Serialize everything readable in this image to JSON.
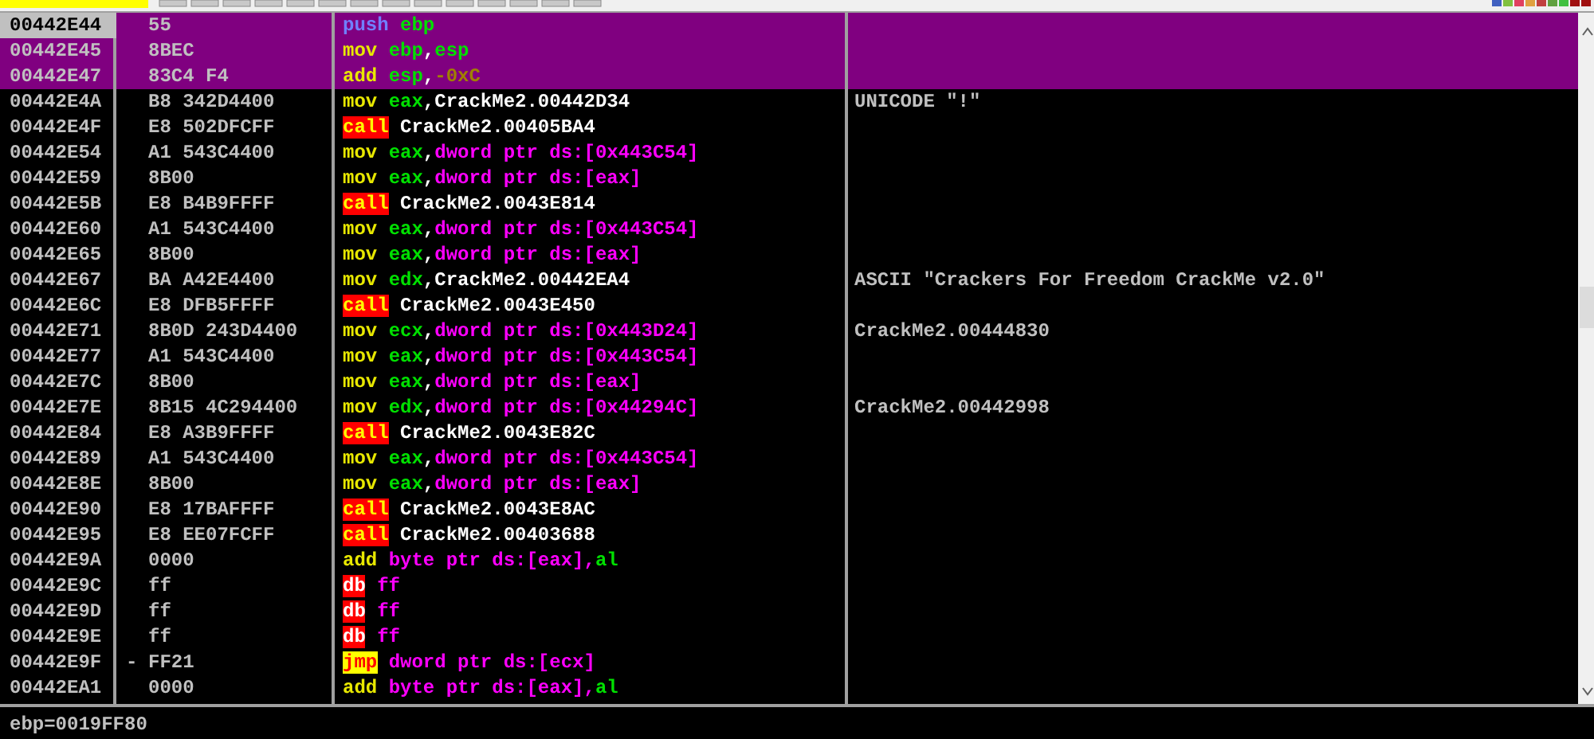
{
  "rows": [
    {
      "address": "00442E44",
      "hex": "55",
      "selected": true,
      "cursor": true,
      "mnemonic": {
        "text": "push",
        "kind": "push"
      },
      "operands": [
        {
          "text": "ebp",
          "kind": "reg"
        }
      ]
    },
    {
      "address": "00442E45",
      "hex": "8BEC",
      "selected": true,
      "cursor": false,
      "mnemonic": {
        "text": "mov",
        "kind": "op"
      },
      "operands": [
        {
          "text": "ebp",
          "kind": "reg"
        },
        {
          "text": ",",
          "kind": "plain"
        },
        {
          "text": "esp",
          "kind": "reg"
        }
      ]
    },
    {
      "address": "00442E47",
      "hex": "83C4 F4",
      "selected": true,
      "cursor": false,
      "mnemonic": {
        "text": "add",
        "kind": "op"
      },
      "operands": [
        {
          "text": "esp",
          "kind": "reg"
        },
        {
          "text": ",",
          "kind": "plain"
        },
        {
          "text": "-0xC",
          "kind": "const"
        }
      ]
    },
    {
      "address": "00442E4A",
      "hex": "B8 342D4400",
      "selected": false,
      "cursor": false,
      "mnemonic": {
        "text": "mov",
        "kind": "op"
      },
      "operands": [
        {
          "text": "eax",
          "kind": "reg"
        },
        {
          "text": ",CrackMe2.00442D34",
          "kind": "plain"
        }
      ],
      "comment": "UNICODE \"!\""
    },
    {
      "address": "00442E4F",
      "hex": "E8 502DFCFF",
      "selected": false,
      "cursor": false,
      "mnemonic": {
        "text": "call",
        "kind": "call"
      },
      "operands": [
        {
          "text": "CrackMe2.00405BA4",
          "kind": "plain"
        }
      ]
    },
    {
      "address": "00442E54",
      "hex": "A1 543C4400",
      "selected": false,
      "cursor": false,
      "mnemonic": {
        "text": "mov",
        "kind": "op"
      },
      "operands": [
        {
          "text": "eax",
          "kind": "reg"
        },
        {
          "text": ",",
          "kind": "plain"
        },
        {
          "text": "dword ptr ds:[0x443C54]",
          "kind": "mem"
        }
      ]
    },
    {
      "address": "00442E59",
      "hex": "8B00",
      "selected": false,
      "cursor": false,
      "mnemonic": {
        "text": "mov",
        "kind": "op"
      },
      "operands": [
        {
          "text": "eax",
          "kind": "reg"
        },
        {
          "text": ",",
          "kind": "plain"
        },
        {
          "text": "dword ptr ds:[eax]",
          "kind": "mem"
        }
      ]
    },
    {
      "address": "00442E5B",
      "hex": "E8 B4B9FFFF",
      "selected": false,
      "cursor": false,
      "mnemonic": {
        "text": "call",
        "kind": "call"
      },
      "operands": [
        {
          "text": "CrackMe2.0043E814",
          "kind": "plain"
        }
      ]
    },
    {
      "address": "00442E60",
      "hex": "A1 543C4400",
      "selected": false,
      "cursor": false,
      "mnemonic": {
        "text": "mov",
        "kind": "op"
      },
      "operands": [
        {
          "text": "eax",
          "kind": "reg"
        },
        {
          "text": ",",
          "kind": "plain"
        },
        {
          "text": "dword ptr ds:[0x443C54]",
          "kind": "mem"
        }
      ]
    },
    {
      "address": "00442E65",
      "hex": "8B00",
      "selected": false,
      "cursor": false,
      "mnemonic": {
        "text": "mov",
        "kind": "op"
      },
      "operands": [
        {
          "text": "eax",
          "kind": "reg"
        },
        {
          "text": ",",
          "kind": "plain"
        },
        {
          "text": "dword ptr ds:[eax]",
          "kind": "mem"
        }
      ]
    },
    {
      "address": "00442E67",
      "hex": "BA A42E4400",
      "selected": false,
      "cursor": false,
      "mnemonic": {
        "text": "mov",
        "kind": "op"
      },
      "operands": [
        {
          "text": "edx",
          "kind": "reg"
        },
        {
          "text": ",CrackMe2.00442EA4",
          "kind": "plain"
        }
      ],
      "comment": "ASCII \"Crackers For Freedom CrackMe v2.0\""
    },
    {
      "address": "00442E6C",
      "hex": "E8 DFB5FFFF",
      "selected": false,
      "cursor": false,
      "mnemonic": {
        "text": "call",
        "kind": "call"
      },
      "operands": [
        {
          "text": "CrackMe2.0043E450",
          "kind": "plain"
        }
      ]
    },
    {
      "address": "00442E71",
      "hex": "8B0D 243D4400",
      "selected": false,
      "cursor": false,
      "mnemonic": {
        "text": "mov",
        "kind": "op"
      },
      "operands": [
        {
          "text": "ecx",
          "kind": "reg"
        },
        {
          "text": ",",
          "kind": "plain"
        },
        {
          "text": "dword ptr ds:[0x443D24]",
          "kind": "mem"
        }
      ],
      "comment": "CrackMe2.00444830"
    },
    {
      "address": "00442E77",
      "hex": "A1 543C4400",
      "selected": false,
      "cursor": false,
      "mnemonic": {
        "text": "mov",
        "kind": "op"
      },
      "operands": [
        {
          "text": "eax",
          "kind": "reg"
        },
        {
          "text": ",",
          "kind": "plain"
        },
        {
          "text": "dword ptr ds:[0x443C54]",
          "kind": "mem"
        }
      ]
    },
    {
      "address": "00442E7C",
      "hex": "8B00",
      "selected": false,
      "cursor": false,
      "mnemonic": {
        "text": "mov",
        "kind": "op"
      },
      "operands": [
        {
          "text": "eax",
          "kind": "reg"
        },
        {
          "text": ",",
          "kind": "plain"
        },
        {
          "text": "dword ptr ds:[eax]",
          "kind": "mem"
        }
      ]
    },
    {
      "address": "00442E7E",
      "hex": "8B15 4C294400",
      "selected": false,
      "cursor": false,
      "mnemonic": {
        "text": "mov",
        "kind": "op"
      },
      "operands": [
        {
          "text": "edx",
          "kind": "reg"
        },
        {
          "text": ",",
          "kind": "plain"
        },
        {
          "text": "dword ptr ds:[0x44294C]",
          "kind": "mem"
        }
      ],
      "comment": "CrackMe2.00442998"
    },
    {
      "address": "00442E84",
      "hex": "E8 A3B9FFFF",
      "selected": false,
      "cursor": false,
      "mnemonic": {
        "text": "call",
        "kind": "call"
      },
      "operands": [
        {
          "text": "CrackMe2.0043E82C",
          "kind": "plain"
        }
      ]
    },
    {
      "address": "00442E89",
      "hex": "A1 543C4400",
      "selected": false,
      "cursor": false,
      "mnemonic": {
        "text": "mov",
        "kind": "op"
      },
      "operands": [
        {
          "text": "eax",
          "kind": "reg"
        },
        {
          "text": ",",
          "kind": "plain"
        },
        {
          "text": "dword ptr ds:[0x443C54]",
          "kind": "mem"
        }
      ]
    },
    {
      "address": "00442E8E",
      "hex": "8B00",
      "selected": false,
      "cursor": false,
      "mnemonic": {
        "text": "mov",
        "kind": "op"
      },
      "operands": [
        {
          "text": "eax",
          "kind": "reg"
        },
        {
          "text": ",",
          "kind": "plain"
        },
        {
          "text": "dword ptr ds:[eax]",
          "kind": "mem"
        }
      ]
    },
    {
      "address": "00442E90",
      "hex": "E8 17BAFFFF",
      "selected": false,
      "cursor": false,
      "mnemonic": {
        "text": "call",
        "kind": "call"
      },
      "operands": [
        {
          "text": "CrackMe2.0043E8AC",
          "kind": "plain"
        }
      ]
    },
    {
      "address": "00442E95",
      "hex": "E8 EE07FCFF",
      "selected": false,
      "cursor": false,
      "mnemonic": {
        "text": "call",
        "kind": "call"
      },
      "operands": [
        {
          "text": "CrackMe2.00403688",
          "kind": "plain"
        }
      ]
    },
    {
      "address": "00442E9A",
      "hex": "0000",
      "selected": false,
      "cursor": false,
      "mnemonic": {
        "text": "add",
        "kind": "op"
      },
      "operands": [
        {
          "text": "byte ptr ds:[eax],",
          "kind": "mem"
        },
        {
          "text": "al",
          "kind": "reg"
        }
      ]
    },
    {
      "address": "00442E9C",
      "hex": "ff",
      "selected": false,
      "cursor": false,
      "mnemonic": {
        "text": "db",
        "kind": "db"
      },
      "operands": [
        {
          "text": "ff",
          "kind": "mem"
        }
      ]
    },
    {
      "address": "00442E9D",
      "hex": "ff",
      "selected": false,
      "cursor": false,
      "mnemonic": {
        "text": "db",
        "kind": "db"
      },
      "operands": [
        {
          "text": "ff",
          "kind": "mem"
        }
      ]
    },
    {
      "address": "00442E9E",
      "hex": "ff",
      "selected": false,
      "cursor": false,
      "mnemonic": {
        "text": "db",
        "kind": "db"
      },
      "operands": [
        {
          "text": "ff",
          "kind": "mem"
        }
      ]
    },
    {
      "address": "00442E9F",
      "marker": "-",
      "hex": "FF21",
      "selected": false,
      "cursor": false,
      "mnemonic": {
        "text": "jmp",
        "kind": "jmp"
      },
      "operands": [
        {
          "text": "dword ptr ds:[ecx]",
          "kind": "mem"
        }
      ]
    },
    {
      "address": "00442EA1",
      "hex": "0000",
      "selected": false,
      "cursor": false,
      "mnemonic": {
        "text": "add",
        "kind": "op"
      },
      "operands": [
        {
          "text": "byte ptr ds:[eax],",
          "kind": "mem"
        },
        {
          "text": "al",
          "kind": "reg"
        }
      ]
    }
  ],
  "status_bar": {
    "text": "ebp=0019FF80"
  }
}
